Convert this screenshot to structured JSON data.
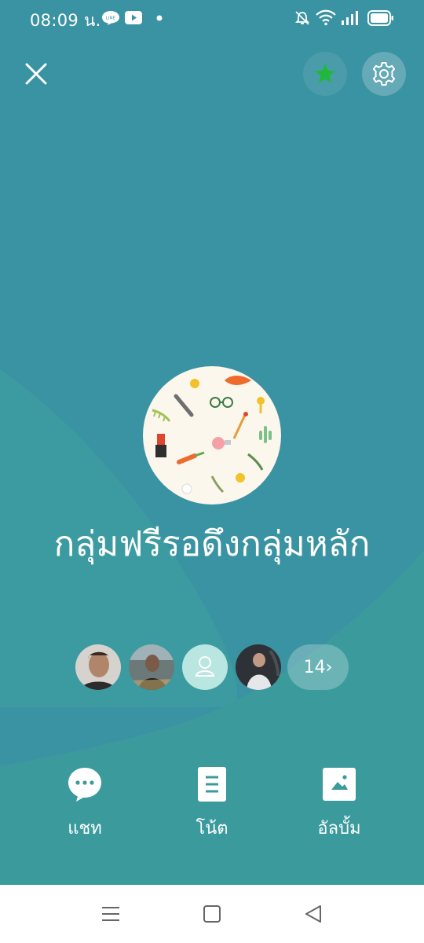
{
  "status_bar": {
    "time": "08:09 น.",
    "left_icons": [
      "line-icon",
      "youtube-icon",
      "dot-icon"
    ],
    "right_icons": [
      "mute-bell-icon",
      "wifi-icon",
      "signal-icon",
      "battery-icon"
    ]
  },
  "header": {
    "close_icon": "close-icon",
    "favorite_icon": "star-icon",
    "settings_icon": "gear-icon"
  },
  "group": {
    "name": "กลุ่มฟรีรอดึงกลุ่มหลัก",
    "member_overflow_label": "14›",
    "members": [
      {
        "type": "photo"
      },
      {
        "type": "photo"
      },
      {
        "type": "default-avatar"
      },
      {
        "type": "photo"
      }
    ]
  },
  "actions": [
    {
      "label": "แชท",
      "icon": "chat-bubble-icon"
    },
    {
      "label": "โน้ต",
      "icon": "note-icon"
    },
    {
      "label": "อัลบั้ม",
      "icon": "album-icon"
    }
  ],
  "navigation": {
    "icons": [
      "menu-icon",
      "home-square-icon",
      "back-triangle-icon"
    ]
  },
  "colors": {
    "background_dark": "#3a93a2",
    "background_wave": "#3c9aa0",
    "bottom_band": "#3a9a9c",
    "star_green": "#1fb83c",
    "avatar_bg": "#fcf7ec",
    "default_avatar_bg": "#b9e6e0"
  }
}
